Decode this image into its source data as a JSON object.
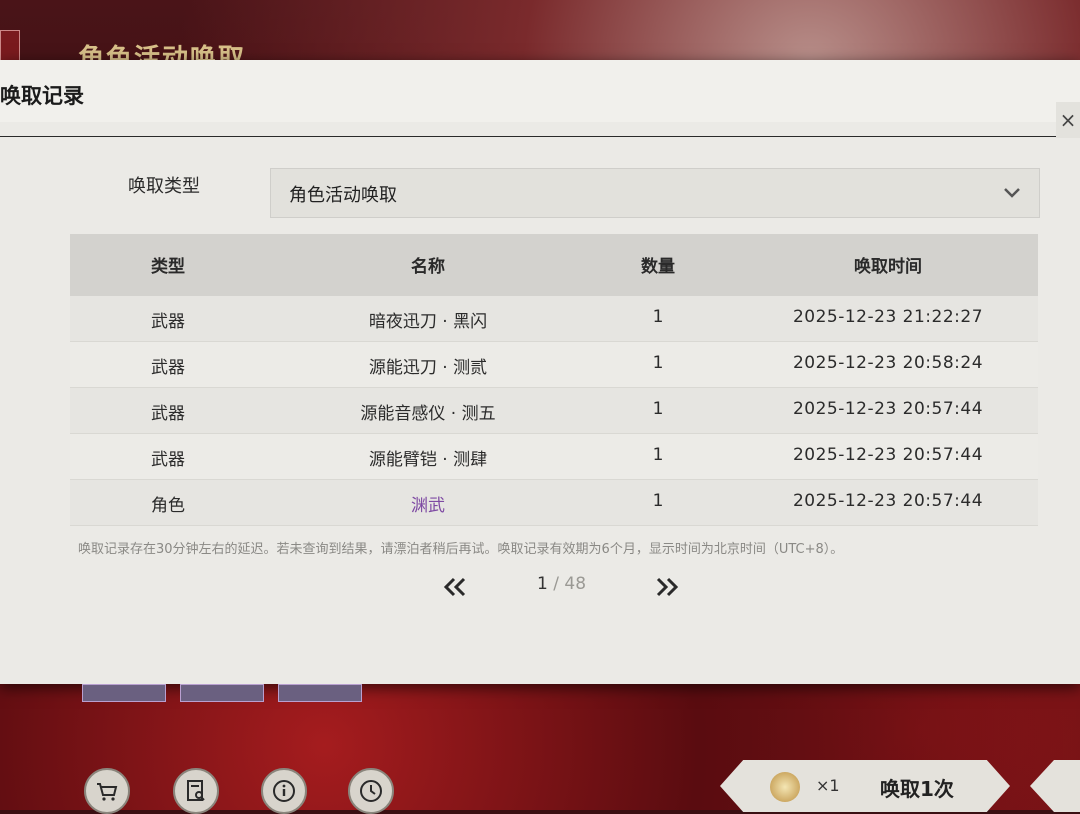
{
  "background": {
    "banner_title": "角色活动唤取"
  },
  "dialog": {
    "title": "唤取记录",
    "filter": {
      "label": "唤取类型",
      "selected": "角色活动唤取"
    },
    "table": {
      "headers": [
        "类型",
        "名称",
        "数量",
        "唤取时间"
      ],
      "rows": [
        {
          "type": "武器",
          "name": "暗夜迅刀 · 黑闪",
          "qty": "1",
          "time": "2025-12-23 21:22:27"
        },
        {
          "type": "武器",
          "name": "源能迅刀 · 测贰",
          "qty": "1",
          "time": "2025-12-23 20:58:24"
        },
        {
          "type": "武器",
          "name": "源能音感仪 · 测五",
          "qty": "1",
          "time": "2025-12-23 20:57:44"
        },
        {
          "type": "武器",
          "name": "源能臂铠 · 测肆",
          "qty": "1",
          "time": "2025-12-23 20:57:44"
        },
        {
          "type": "角色",
          "name": "渊武",
          "qty": "1",
          "time": "2025-12-23 20:57:44"
        }
      ]
    },
    "footnote": "唤取记录存在30分钟左右的延迟。若未查询到结果，请漂泊者稍后再试。唤取记录有效期为6个月，显示时间为北京时间（UTC+8）。",
    "pager": {
      "current": "1",
      "separator": " / ",
      "total": "48"
    }
  },
  "bottom_bar": {
    "icons": [
      "cart-icon",
      "record-search-icon",
      "info-icon",
      "history-icon"
    ],
    "pull": {
      "count": "×1",
      "label": "唤取1次"
    }
  },
  "colors": {
    "dialog_bg": "#ebeae6",
    "header_bg": "#d3d2ce",
    "highlight_name": "#7e4aa3",
    "banner_gold": "#d8c089"
  }
}
